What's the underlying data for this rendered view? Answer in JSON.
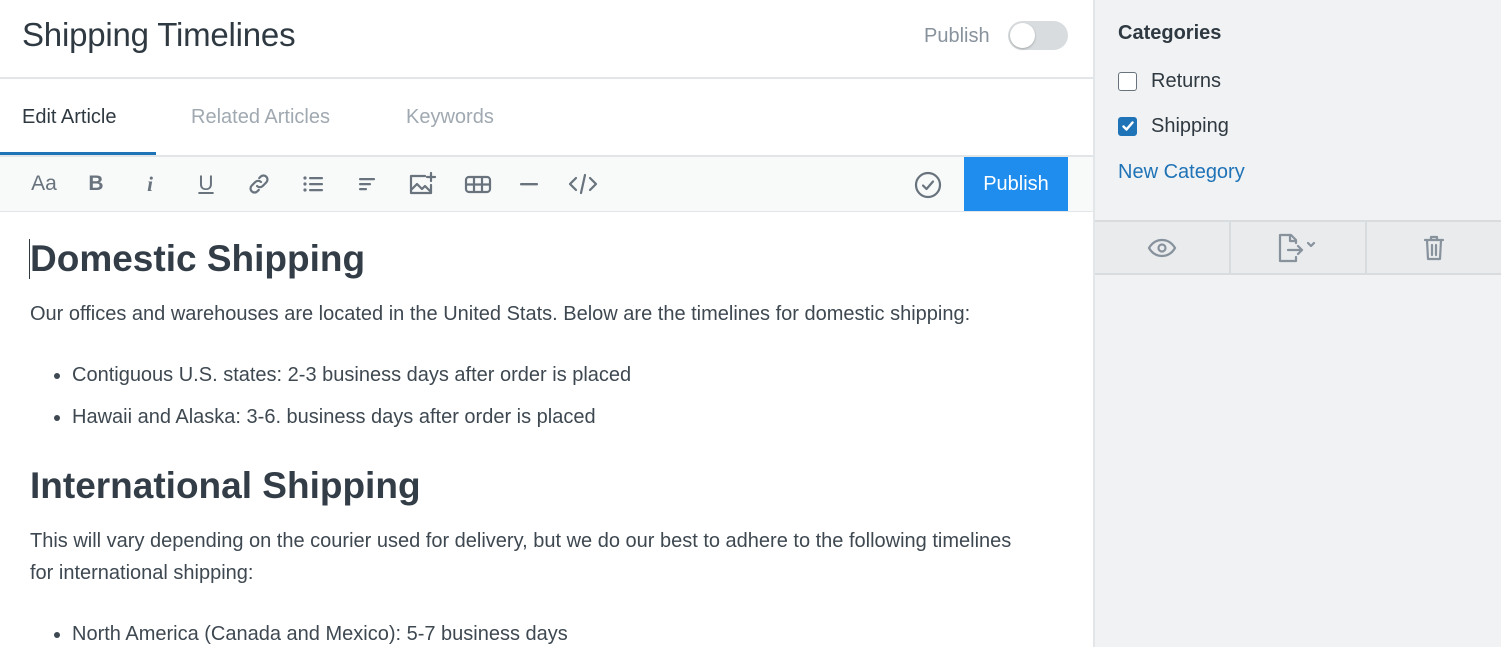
{
  "header": {
    "title": "Shipping Timelines",
    "toggle_label": "Publish",
    "toggle_on": false
  },
  "tabs": [
    {
      "label": "Edit Article",
      "active": true
    },
    {
      "label": "Related Articles",
      "active": false
    },
    {
      "label": "Keywords",
      "active": false
    }
  ],
  "toolbar": {
    "font_size_label": "Aa",
    "bold_label": "B",
    "italic_label": "i",
    "underline_label": "U",
    "tools": [
      "font-size-icon",
      "bold-icon",
      "italic-icon",
      "underline-icon",
      "link-icon",
      "bulleted-list-icon",
      "align-icon",
      "image-add-icon",
      "table-icon",
      "horizontal-rule-icon",
      "code-icon",
      "check-circle-icon"
    ],
    "publish_label": "Publish",
    "accent": "#1f8ded"
  },
  "article": {
    "heading_1": "Domestic Shipping",
    "paragraph_1": "Our offices and warehouses are located in the United Stats. Below are the timelines for domestic shipping:",
    "list_1": [
      "Contiguous U.S. states: 2-3 business days after order is placed",
      "Hawaii and Alaska: 3-6. business days after order is placed"
    ],
    "heading_2": "International Shipping",
    "paragraph_2": "This will vary depending on the courier used for delivery, but we do our best to adhere to the following timelines for international shipping:",
    "list_2": [
      "North America (Canada and Mexico): 5-7 business days"
    ]
  },
  "sidebar": {
    "categories_title": "Categories",
    "categories": [
      {
        "label": "Returns",
        "checked": false
      },
      {
        "label": "Shipping",
        "checked": true
      }
    ],
    "new_category_label": "New Category",
    "actions": [
      "eye-icon",
      "export-icon",
      "trash-icon"
    ],
    "link_color": "#1f73b7"
  }
}
